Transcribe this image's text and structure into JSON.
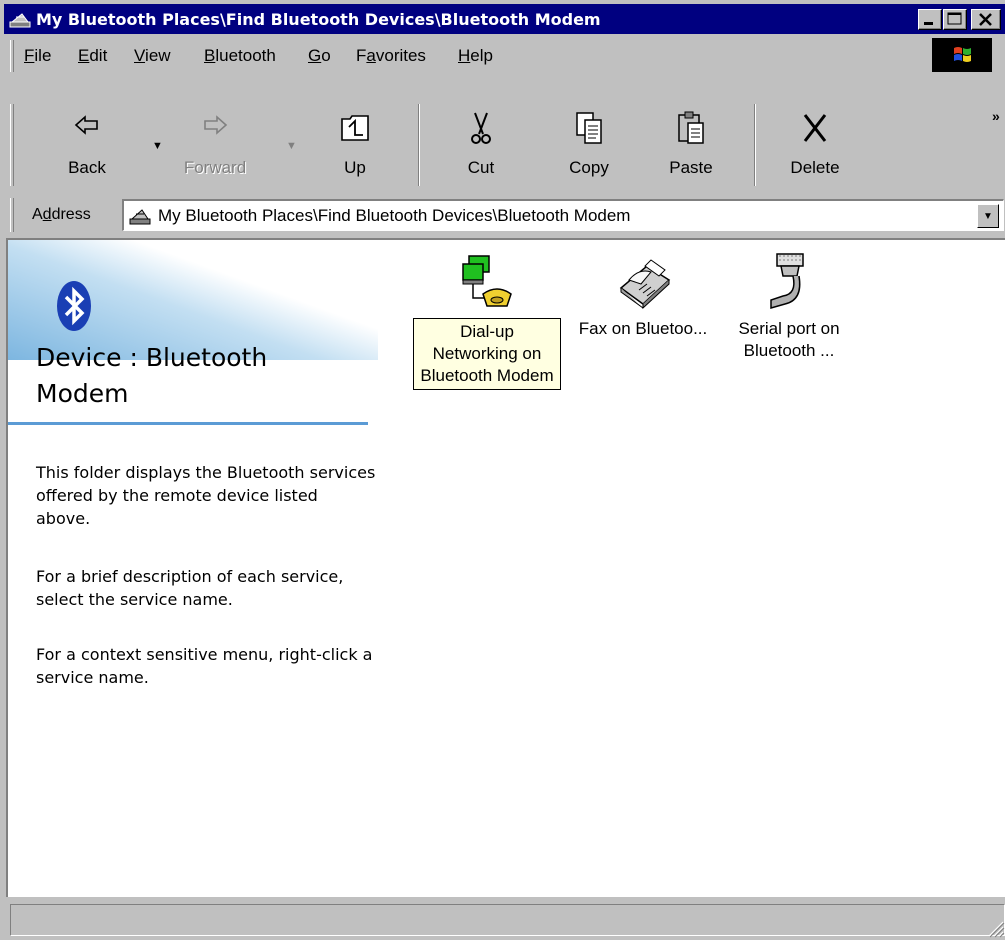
{
  "window": {
    "title": "My Bluetooth Places\\Find Bluetooth Devices\\Bluetooth Modem",
    "accent": "#000080"
  },
  "menu": {
    "items": [
      {
        "label": "File",
        "mnemonic": "F"
      },
      {
        "label": "Edit",
        "mnemonic": "E"
      },
      {
        "label": "View",
        "mnemonic": "V"
      },
      {
        "label": "Bluetooth",
        "mnemonic": "B"
      },
      {
        "label": "Go",
        "mnemonic": "G"
      },
      {
        "label": "Favorites",
        "mnemonic": "a"
      },
      {
        "label": "Help",
        "mnemonic": "H"
      }
    ]
  },
  "toolbar": {
    "back": "Back",
    "forward": "Forward",
    "up": "Up",
    "cut": "Cut",
    "copy": "Copy",
    "paste": "Paste",
    "delete": "Delete",
    "more": "»"
  },
  "address": {
    "label": "Address",
    "value": "My Bluetooth Places\\Find Bluetooth Devices\\Bluetooth Modem"
  },
  "webview": {
    "title": "Device : Bluetooth Modem",
    "paragraphs": [
      "This folder displays the Bluetooth services offered by the remote device listed above.",
      "For a brief description of each service, select the service name.",
      "For a context sensitive menu, right-click a service name."
    ],
    "accent": "#5b9bd5"
  },
  "files": [
    {
      "label": "Dial-up Networking on Bluetooth Modem",
      "icon": "dialup-networking-icon",
      "selected": true
    },
    {
      "label": "Fax on Bluetoo...",
      "icon": "fax-icon",
      "selected": false
    },
    {
      "label": "Serial port on Bluetooth ...",
      "icon": "serial-port-icon",
      "selected": false
    }
  ],
  "statusbar": {
    "text": ""
  }
}
